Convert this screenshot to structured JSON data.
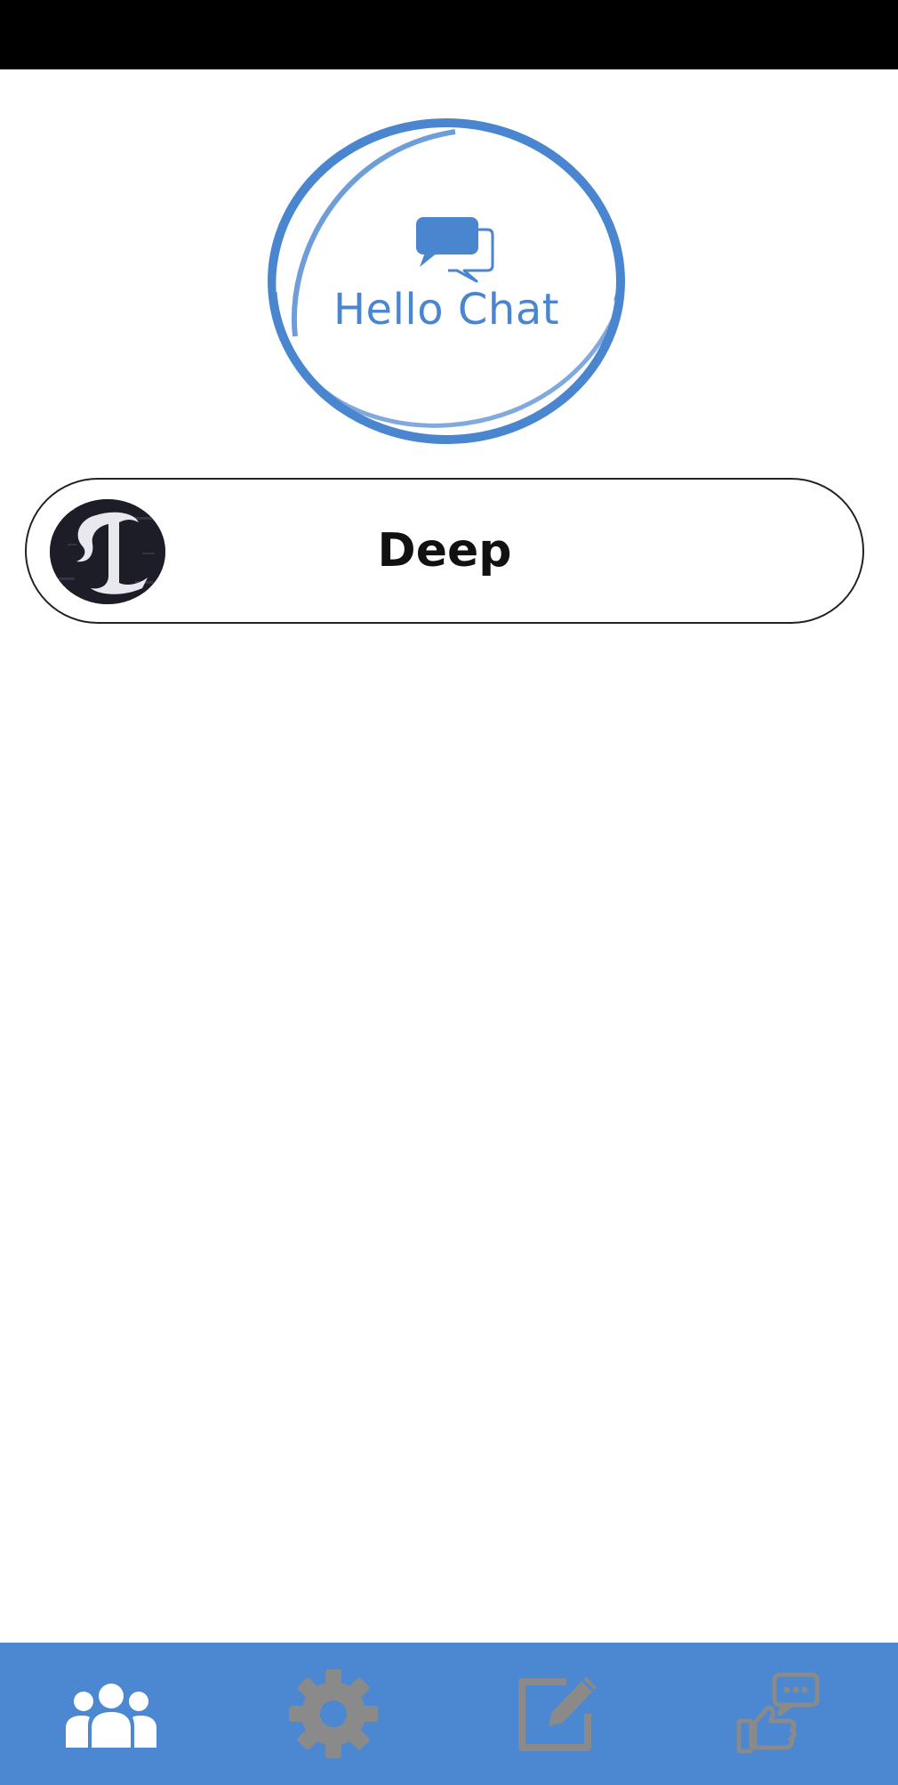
{
  "app": {
    "logo_text": "Hello Chat"
  },
  "contacts": [
    {
      "name": "Deep",
      "avatar": "letter-l-emblem-avatar"
    }
  ],
  "bottom_nav": {
    "items": [
      {
        "icon": "users-icon",
        "active": true
      },
      {
        "icon": "gear-icon",
        "active": false
      },
      {
        "icon": "edit-icon",
        "active": false
      },
      {
        "icon": "feedback-icon",
        "active": false
      }
    ]
  },
  "colors": {
    "brand_blue": "#4c88d2",
    "nav_active": "#ffffff",
    "nav_inactive": "#8a8a8a"
  }
}
